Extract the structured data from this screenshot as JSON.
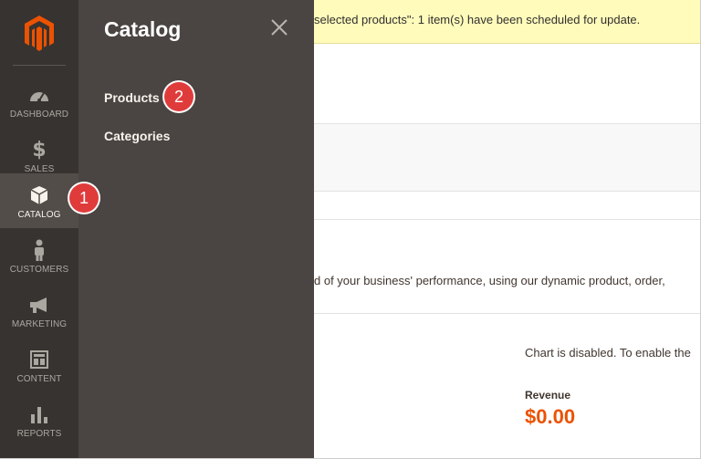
{
  "sidebar": {
    "items": [
      {
        "label": "DASHBOARD",
        "icon": "dashboard-gauge-icon"
      },
      {
        "label": "SALES",
        "icon": "dollar-icon"
      },
      {
        "label": "CATALOG",
        "icon": "box-icon"
      },
      {
        "label": "CUSTOMERS",
        "icon": "person-icon"
      },
      {
        "label": "MARKETING",
        "icon": "megaphone-icon"
      },
      {
        "label": "CONTENT",
        "icon": "layout-icon"
      },
      {
        "label": "REPORTS",
        "icon": "bar-chart-icon"
      }
    ],
    "active": "CATALOG"
  },
  "flyout": {
    "title": "Catalog",
    "links": [
      "Products",
      "Categories"
    ]
  },
  "steps": {
    "catalog": "1",
    "products": "2"
  },
  "page": {
    "notice": "selected products\": 1 item(s) have been scheduled for update.",
    "intro": "d of your business' performance, using our dynamic product, order,",
    "chart_disabled": "Chart is disabled. To enable the",
    "revenue_label": "Revenue",
    "revenue_value": "$0.00"
  },
  "colors": {
    "sidebar": "#373330",
    "flyout": "#4a4542",
    "accent": "#eb5202",
    "marker": "#e03b3b",
    "notice": "#fffbbb"
  }
}
